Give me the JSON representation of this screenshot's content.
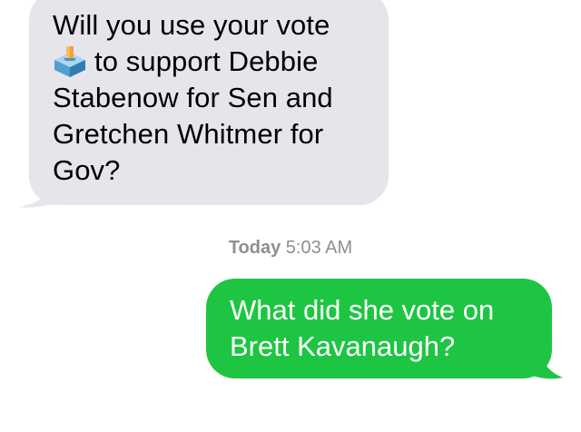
{
  "conversation": {
    "incoming": {
      "line1": "Will you use your vote",
      "line2": "to support Debbie",
      "line3": "Stabenow for Sen and",
      "line4": "Gretchen Whitmer for",
      "line5": "Gov?",
      "emoji": "ballot-box-icon",
      "bubble_color": "#e6e5eb"
    },
    "timestamp": {
      "day": "Today",
      "time": "5:03 AM"
    },
    "outgoing": {
      "line1": "What did she vote on",
      "line2": "Brett Kavanaugh?",
      "bubble_color": "#1ec543"
    }
  }
}
